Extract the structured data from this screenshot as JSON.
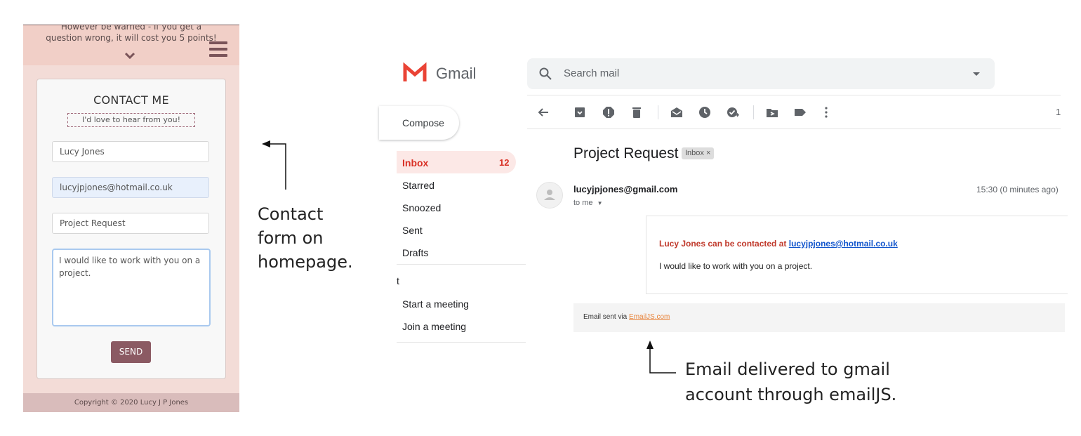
{
  "left_form": {
    "warning_line1": "However be warned - if you get a",
    "warning_line2": "question wrong, it will cost you 5 points!",
    "title": "CONTACT ME",
    "subtitle": "I'd love to hear from you!",
    "name_value": "Lucy Jones",
    "email_value": "lucyjpjones@hotmail.co.uk",
    "subject_value": "Project Request",
    "message_value": "I would like to work with you on a project.",
    "send_label": "SEND",
    "footer": "Copyright © 2020 Lucy J P Jones",
    "colors": {
      "header": "#f1cfc7",
      "send": "#8b5a63",
      "footer": "#d9bcbb"
    }
  },
  "annotations": {
    "left_line1": "Contact",
    "left_line2": "form on",
    "left_line3": "homepage.",
    "right_line1": "Email delivered to gmail",
    "right_line2": "account through emailJS."
  },
  "gmail": {
    "brand": "Gmail",
    "search_placeholder": "Search mail",
    "compose_label": "Compose",
    "nav": {
      "inbox_label": "Inbox",
      "inbox_count": "12",
      "starred": "Starred",
      "snoozed": "Snoozed",
      "sent": "Sent",
      "drafts": "Drafts",
      "meet_heading": "t",
      "start_meeting": "Start a meeting",
      "join_meeting": "Join a meeting"
    },
    "toolbar_icons": [
      "back-arrow-icon",
      "archive-icon",
      "report-spam-icon",
      "delete-icon",
      "mark-unread-icon",
      "snooze-icon",
      "add-to-tasks-icon",
      "move-to-icon",
      "label-icon",
      "more-icon"
    ],
    "page_indicator": "1",
    "email": {
      "subject": "Project Request",
      "label_chip": "Inbox ×",
      "sender": "lucyjpjones@gmail.com",
      "to": "to me",
      "time": "15:30 (0 minutes ago)",
      "line1_prefix": "Lucy Jones can be contacted at ",
      "line1_link": "lucyjpjones@hotmail.co.uk",
      "line2": "I would like to work with you on a project.",
      "sent_via_prefix": "Email sent via ",
      "sent_via_link": "EmailJS.com"
    }
  }
}
